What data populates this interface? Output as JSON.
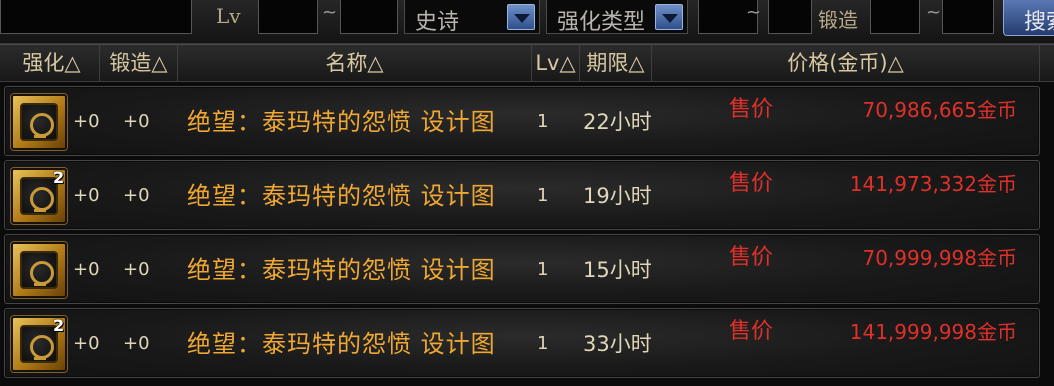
{
  "filter": {
    "lv_label": "Lv",
    "tilde1": "~",
    "rarity_selected": "史诗",
    "enhance_type_selected": "强化类型",
    "tilde2": "~",
    "forge_label": "锻造",
    "tilde3": "~",
    "search_label": "搜索"
  },
  "columns": {
    "enhance": "强化△",
    "forge": "锻造△",
    "name": "名称△",
    "lv": "Lv△",
    "period": "期限△",
    "price": "价格(金币)△"
  },
  "rows": [
    {
      "icon": "blueprint-icon",
      "count": "",
      "enhance": "+0",
      "forge": "+0",
      "name": "绝望：泰玛特的怨愤  设计图",
      "lv": "1",
      "period": "22小时",
      "sale": "售价",
      "price": "70,986,665金币"
    },
    {
      "icon": "blueprint-icon",
      "count": "2",
      "enhance": "+0",
      "forge": "+0",
      "name": "绝望：泰玛特的怨愤  设计图",
      "lv": "1",
      "period": "19小时",
      "sale": "售价",
      "price": "141,973,332金币"
    },
    {
      "icon": "blueprint-icon",
      "count": "",
      "enhance": "+0",
      "forge": "+0",
      "name": "绝望：泰玛特的怨愤  设计图",
      "lv": "1",
      "period": "15小时",
      "sale": "售价",
      "price": "70,999,998金币"
    },
    {
      "icon": "blueprint-icon",
      "count": "2",
      "enhance": "+0",
      "forge": "+0",
      "name": "绝望：泰玛特的怨愤  设计图",
      "lv": "1",
      "period": "33小时",
      "sale": "售价",
      "price": "141,999,998金币"
    }
  ],
  "colors": {
    "name_text": "#f0a832",
    "price_text": "#e0302a",
    "accent_blue": "#5a78b4"
  }
}
